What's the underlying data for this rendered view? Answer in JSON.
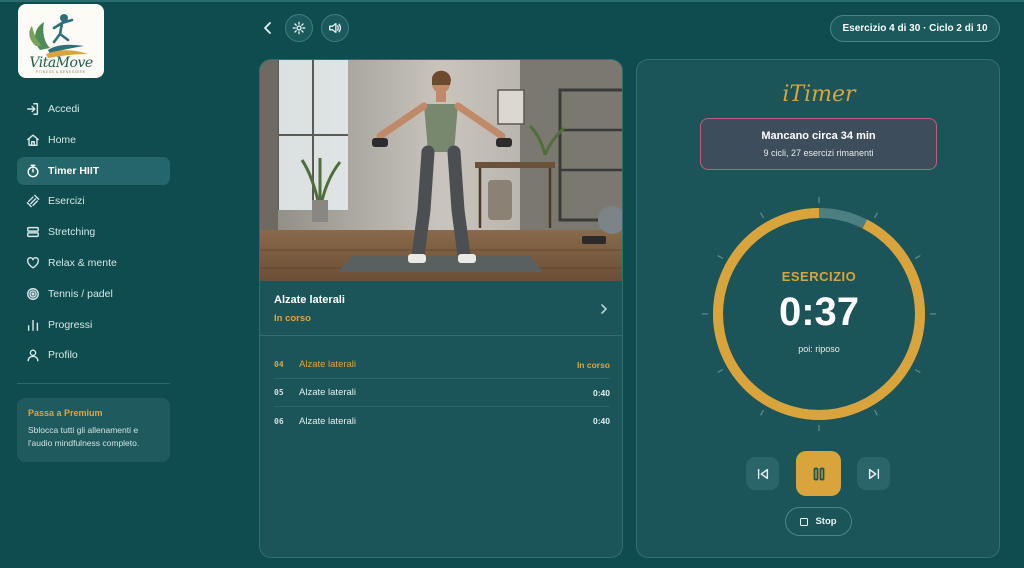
{
  "app": {
    "logo_text": "VitaMove",
    "logo_tagline": "FITNESS & BENESSERE"
  },
  "sidebar": {
    "items": [
      {
        "label": "Accedi",
        "icon": "login-icon"
      },
      {
        "label": "Home",
        "icon": "home-icon"
      },
      {
        "label": "Timer HIIT",
        "icon": "stopwatch-icon",
        "active": true
      },
      {
        "label": "Esercizi",
        "icon": "dumbbell-icon"
      },
      {
        "label": "Stretching",
        "icon": "stretching-icon"
      },
      {
        "label": "Relax & mente",
        "icon": "heart-icon"
      },
      {
        "label": "Tennis / padel",
        "icon": "target-icon"
      },
      {
        "label": "Progressi",
        "icon": "bar-chart-icon"
      },
      {
        "label": "Profilo",
        "icon": "user-icon"
      }
    ],
    "premium": {
      "title": "Passa a Premium",
      "text": "Sblocca tutti gli allenamenti e l'audio mindfulness completo."
    }
  },
  "topbar": {
    "progress": "Esercizio 4 di 30 · Ciclo 2 di 10"
  },
  "exercise": {
    "name": "Alzate laterali",
    "status": "In corso",
    "queue": [
      {
        "num": "04",
        "name": "Alzate laterali",
        "time": "In corso",
        "current": true
      },
      {
        "num": "05",
        "name": "Alzate laterali",
        "time": "0:40"
      },
      {
        "num": "06",
        "name": "Alzate laterali",
        "time": "0:40"
      }
    ]
  },
  "timer": {
    "brand": "iTimer",
    "remaining_title": "Mancano circa 34 min",
    "remaining_sub": "9 cicli, 27 esercizi rimanenti",
    "phase": "ESERCIZIO",
    "time": "0:37",
    "next": "poi: riposo",
    "progress_fraction": 0.925,
    "stop_label": "Stop"
  },
  "colors": {
    "background": "#0f4c4f",
    "card": "#1b5559",
    "accent": "#d9a43c",
    "alert_border": "#c55b77"
  }
}
